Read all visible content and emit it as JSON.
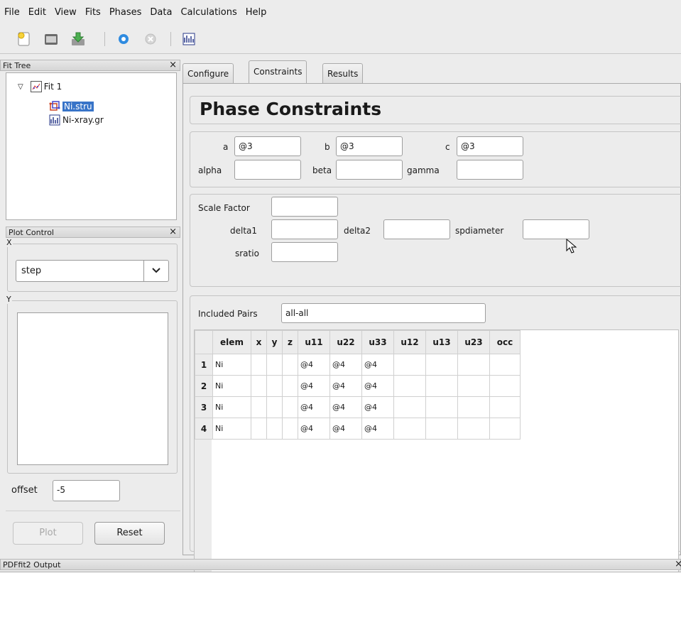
{
  "menu": [
    "File",
    "Edit",
    "View",
    "Fits",
    "Phases",
    "Data",
    "Calculations",
    "Help"
  ],
  "toolbar": {
    "icons": [
      "new-icon",
      "open-icon",
      "save-icon",
      "run-icon",
      "stop-icon",
      "plot-icon"
    ]
  },
  "fit_tree": {
    "title": "Fit Tree",
    "close": "×",
    "fit_label": "Fit 1",
    "phase_label": "Ni.stru",
    "data_label": "Ni-xray.gr"
  },
  "plot_control": {
    "title": "Plot Control",
    "close": "×",
    "x_group": "X",
    "x_value": "step",
    "y_group": "Y",
    "offset_label": "offset",
    "offset_value": "-5",
    "plot_button": "Plot",
    "reset_button": "Reset"
  },
  "tabs": [
    "Configure",
    "Constraints",
    "Results"
  ],
  "constraints": {
    "heading": "Phase Constraints",
    "lattice": {
      "a_label": "a",
      "a_value": "@3",
      "b_label": "b",
      "b_value": "@3",
      "c_label": "c",
      "c_value": "@3",
      "alpha_label": "alpha",
      "alpha_value": "",
      "beta_label": "beta",
      "beta_value": "",
      "gamma_label": "gamma",
      "gamma_value": ""
    },
    "params": {
      "scale_label": "Scale Factor",
      "scale_value": "",
      "delta1_label": "delta1",
      "delta1_value": "",
      "delta2_label": "delta2",
      "delta2_value": "",
      "spdiameter_label": "spdiameter",
      "spdiameter_value": "",
      "sratio_label": "sratio",
      "sratio_value": ""
    },
    "pairs_label": "Included Pairs",
    "pairs_value": "all-all",
    "table": {
      "headers": [
        "elem",
        "x",
        "y",
        "z",
        "u11",
        "u22",
        "u33",
        "u12",
        "u13",
        "u23",
        "occ"
      ],
      "rows": [
        {
          "num": "1",
          "cells": [
            "Ni",
            "",
            "",
            "",
            "@4",
            "@4",
            "@4",
            "",
            "",
            "",
            ""
          ]
        },
        {
          "num": "2",
          "cells": [
            "Ni",
            "",
            "",
            "",
            "@4",
            "@4",
            "@4",
            "",
            "",
            "",
            ""
          ]
        },
        {
          "num": "3",
          "cells": [
            "Ni",
            "",
            "",
            "",
            "@4",
            "@4",
            "@4",
            "",
            "",
            "",
            ""
          ]
        },
        {
          "num": "4",
          "cells": [
            "Ni",
            "",
            "",
            "",
            "@4",
            "@4",
            "@4",
            "",
            "",
            "",
            ""
          ]
        }
      ]
    }
  },
  "output": {
    "title": "PDFfit2 Output",
    "close": "×"
  }
}
